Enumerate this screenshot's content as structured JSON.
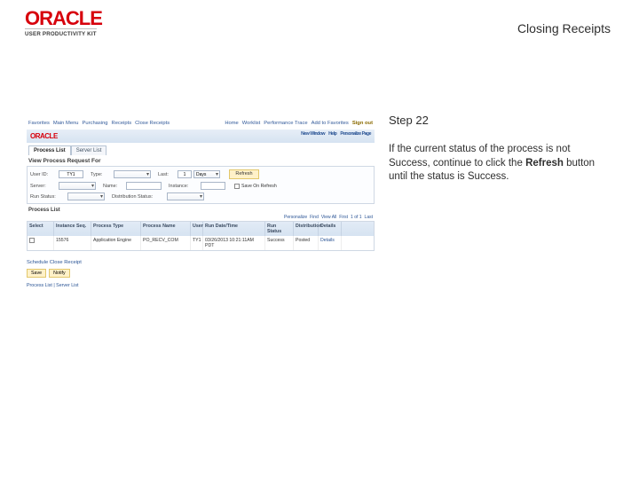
{
  "header": {
    "logo": "ORACLE",
    "logo_subtitle": "USER PRODUCTIVITY KIT",
    "page_title": "Closing Receipts"
  },
  "instruction": {
    "step": "Step 22",
    "body_1": "If the current status of the process is not Success,  continue to click the ",
    "body_bold": "Refresh",
    "body_2": " button until the status is Success."
  },
  "ps": {
    "topnav_left": [
      "Favorites",
      "Main Menu",
      "Purchasing",
      "Receipts",
      "Close Receipts"
    ],
    "topnav_right": [
      "Home",
      "Worklist",
      "Performance Trace",
      "Add to Favorites",
      "Sign out"
    ],
    "brand": "ORACLE",
    "brand_right": [
      "New Window",
      "Help",
      "Personalize Page"
    ],
    "tabs": {
      "active": "Process List",
      "other": "Server List"
    },
    "panel_title": "View Process Request For",
    "filters": {
      "user_label": "User ID:",
      "user_value": "TY1",
      "type_label": "Type:",
      "type_value": "",
      "last_label": "Last:",
      "last_value": "1",
      "last_unit": "Days",
      "refresh_label": "Refresh",
      "server_label": "Server:",
      "server_value": "",
      "name_label": "Name:",
      "name_value": "",
      "instance_label": "Instance:",
      "instance_value": "",
      "save_cb_label": "Save On Refresh",
      "run_label": "Run Status:",
      "run_value": "",
      "dist_label": "Distribution Status:",
      "dist_value": ""
    },
    "grid_title": "Process List",
    "grid_tools": [
      "Personalize",
      "Find",
      "View All",
      "First",
      "1 of 1",
      "Last"
    ],
    "grid_headers": [
      "Select",
      "Instance",
      "Seq.",
      "Process Type",
      "Process Name",
      "User",
      "Run Date/Time",
      "Run Status",
      "Distribution Status",
      "Details"
    ],
    "grid_row": {
      "select": "",
      "instance": "15576",
      "ptype": "Application Engine",
      "pname": "PO_RECV_COM",
      "user": "TY1",
      "rundt": "03/26/2013 10:21:11AM PDT",
      "rstat": "Success",
      "dstat": "Posted",
      "details": "Details"
    },
    "schedule_link": "Schedule Close Receipt",
    "schedule_btns": {
      "save": "Save",
      "notify": "Notify"
    },
    "tabstrip": "Process List | Server List"
  }
}
